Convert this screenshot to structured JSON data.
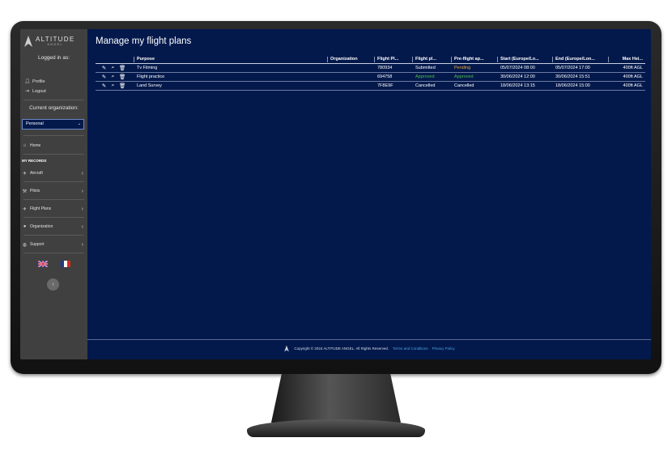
{
  "sidebar": {
    "logo_text": "ALTITUDE",
    "logo_sub": "ANGEL",
    "logged_in_as": "Logged in as:",
    "profile": "Profile",
    "logout": "Logout",
    "current_org_label": "Current organization:",
    "org_select_value": "Personal",
    "home": "Home",
    "my_records": "MY RECORDS",
    "items": [
      {
        "label": "Aircraft",
        "icon": "plane-icon"
      },
      {
        "label": "Pilots",
        "icon": "wrench-icon"
      },
      {
        "label": "Flight Plans",
        "icon": "plane-icon"
      },
      {
        "label": "Organization",
        "icon": "user-icon"
      },
      {
        "label": "Support",
        "icon": "help-icon"
      }
    ],
    "languages": [
      "en-gb",
      "fr"
    ]
  },
  "main": {
    "title": "Manage my flight plans",
    "columns": [
      "Purpose",
      "Organization",
      "Flight Pl...",
      "Flight pl...",
      "Pre-flight ap...",
      "Start (Europe/Lo...",
      "End (Europe/Lon...",
      "Max Hei..."
    ],
    "rows": [
      {
        "purpose": "Tv Filming",
        "organization": "",
        "flight_plan_id": "780934",
        "flight_plan_status": "Submitted",
        "preflight_approval": "Pending",
        "start": "05/07/2024 08:00",
        "end": "05/07/2024 17:00",
        "max_height": "400ft AGL",
        "preflight_color": "#e8a838",
        "status_color": "#ffffff"
      },
      {
        "purpose": "Flight practice",
        "organization": "",
        "flight_plan_id": "694758",
        "flight_plan_status": "Approved",
        "preflight_approval": "Approved",
        "start": "30/06/2024 12:00",
        "end": "30/06/2024 15:51",
        "max_height": "400ft AGL",
        "preflight_color": "#4cbf4a",
        "status_color": "#4cbf4a"
      },
      {
        "purpose": "Land Survey",
        "organization": "",
        "flight_plan_id": "7F8E9F",
        "flight_plan_status": "Cancelled",
        "preflight_approval": "Cancelled",
        "start": "18/06/2024 13:15",
        "end": "18/06/2024 15:00",
        "max_height": "400ft AGL",
        "preflight_color": "#ffffff",
        "status_color": "#ffffff"
      }
    ]
  },
  "footer": {
    "copyright": "Copyright © 2024 ALTITUDE ANGEL. All Rights Reserved.",
    "terms": "Terms and Conditions",
    "privacy": "Privacy Policy"
  },
  "colors": {
    "screen_bg": "#03194c",
    "sidebar_bg": "#404040",
    "link": "#49a7e0"
  }
}
